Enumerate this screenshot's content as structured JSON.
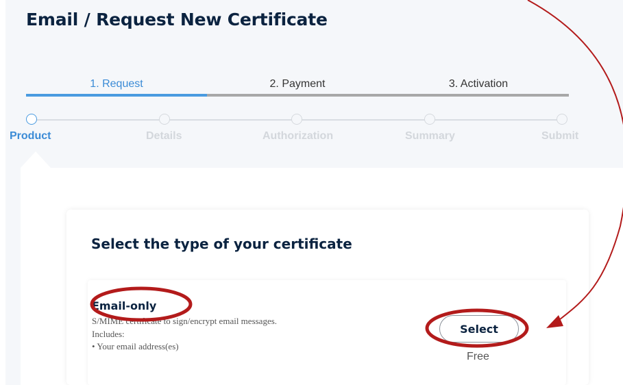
{
  "page": {
    "title": "Email / Request New Certificate"
  },
  "tabs": [
    {
      "label": "1. Request",
      "active": true
    },
    {
      "label": "2. Payment",
      "active": false
    },
    {
      "label": "3. Activation",
      "active": false
    }
  ],
  "steps": [
    {
      "label": "Product",
      "active": true
    },
    {
      "label": "Details",
      "active": false
    },
    {
      "label": "Authorization",
      "active": false
    },
    {
      "label": "Summary",
      "active": false
    },
    {
      "label": "Submit",
      "active": false
    }
  ],
  "card": {
    "title": "Select the type of your certificate",
    "option": {
      "name": "Email-only",
      "description": "S/MIME certificate to sign/encrypt email messages.",
      "includes_label": "Includes:",
      "bullet": "• Your email address(es)",
      "button_label": "Select",
      "price": "Free"
    }
  },
  "colors": {
    "accent": "#4a9be0",
    "title": "#0b2340",
    "annotation": "#b31b1b"
  },
  "icons": [
    "step-dot-icon",
    "annotation-arrow-icon"
  ]
}
